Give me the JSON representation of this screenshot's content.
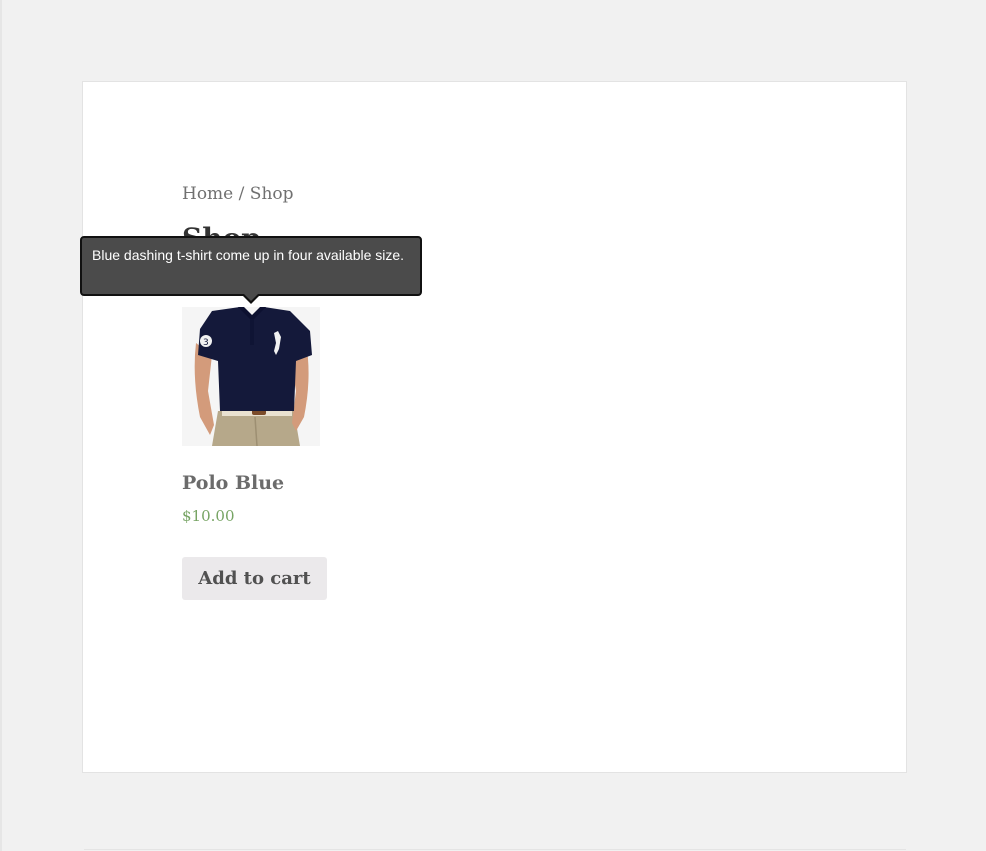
{
  "breadcrumb": {
    "home": "Home",
    "separator": " / ",
    "current": "Shop"
  },
  "page": {
    "title": "Shop"
  },
  "product": {
    "name": "Polo Blue",
    "price": "$10.00",
    "add_to_cart_label": "Add to cart",
    "image_alt": "Polo Blue navy polo shirt",
    "shirt_color": "#14193a",
    "pants_color": "#b6a88a"
  },
  "tooltip": {
    "text": "Blue dashing t-shirt come up in four available size."
  },
  "colors": {
    "background": "#f1f1f1",
    "panel": "#ffffff",
    "price": "#77a464",
    "button": "#ebe9eb",
    "tooltip_bg": "#4b4b4b"
  }
}
